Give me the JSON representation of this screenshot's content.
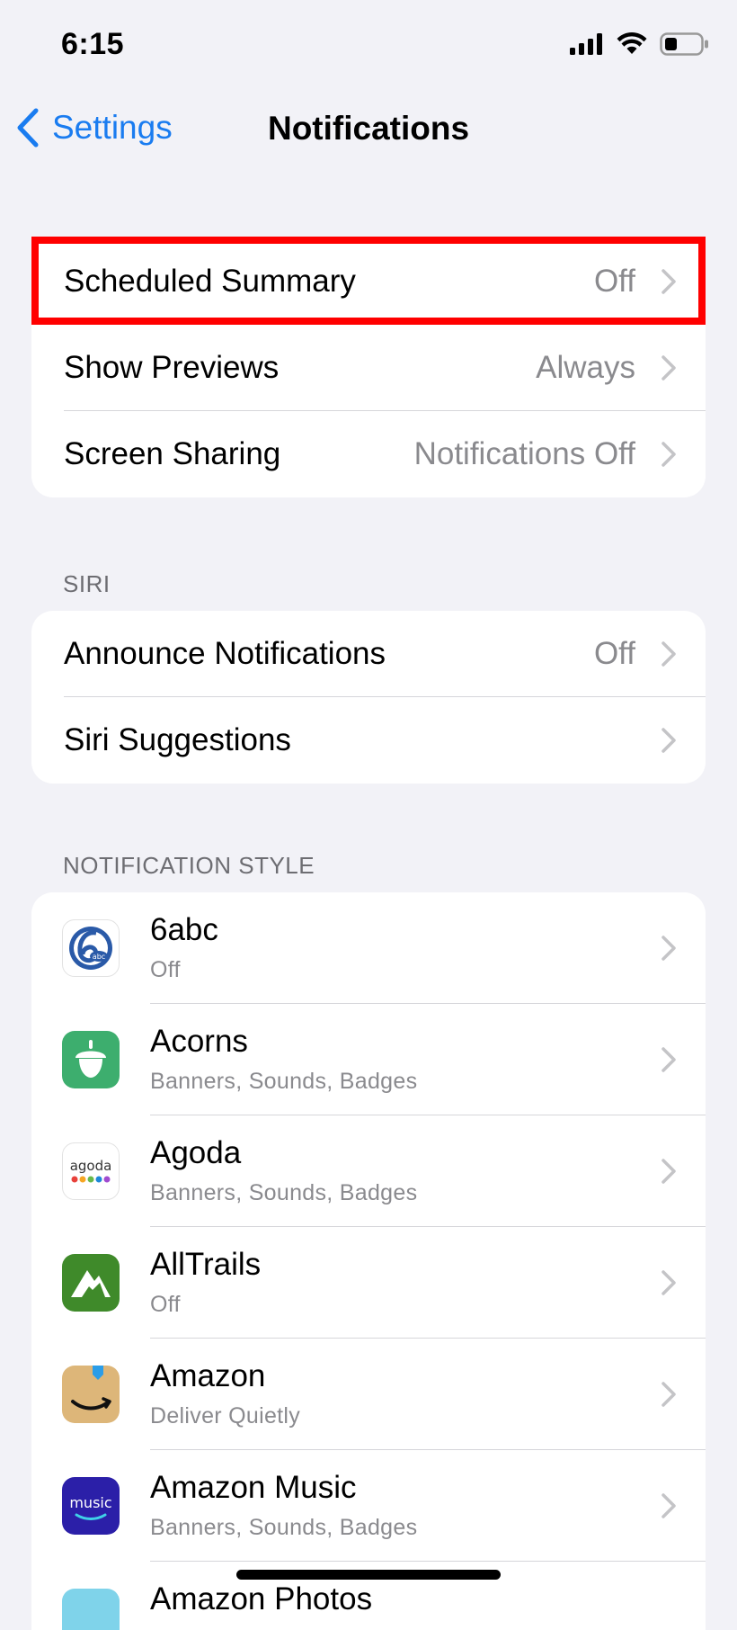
{
  "status_bar": {
    "time": "6:15"
  },
  "nav": {
    "back_label": "Settings",
    "title": "Notifications"
  },
  "group1": [
    {
      "label": "Scheduled Summary",
      "value": "Off"
    },
    {
      "label": "Show Previews",
      "value": "Always"
    },
    {
      "label": "Screen Sharing",
      "value": "Notifications Off"
    }
  ],
  "siri_header": "SIRI",
  "group2": [
    {
      "label": "Announce Notifications",
      "value": "Off"
    },
    {
      "label": "Siri Suggestions",
      "value": ""
    }
  ],
  "style_header": "NOTIFICATION STYLE",
  "apps": [
    {
      "name": "6abc",
      "status": "Off",
      "icon": "6abc-icon"
    },
    {
      "name": "Acorns",
      "status": "Banners, Sounds, Badges",
      "icon": "acorns-icon"
    },
    {
      "name": "Agoda",
      "status": "Banners, Sounds, Badges",
      "icon": "agoda-icon",
      "icon_text": "agoda"
    },
    {
      "name": "AllTrails",
      "status": "Off",
      "icon": "alltrails-icon"
    },
    {
      "name": "Amazon",
      "status": "Deliver Quietly",
      "icon": "amazon-icon"
    },
    {
      "name": "Amazon Music",
      "status": "Banners, Sounds, Badges",
      "icon": "amazon-music-icon",
      "icon_text": "music"
    },
    {
      "name": "Amazon Photos",
      "status": "",
      "icon": "amazon-photos-icon"
    }
  ],
  "colors": {
    "accent": "#1a7cf0",
    "highlight": "#ff0000",
    "background": "#f2f2f7"
  }
}
